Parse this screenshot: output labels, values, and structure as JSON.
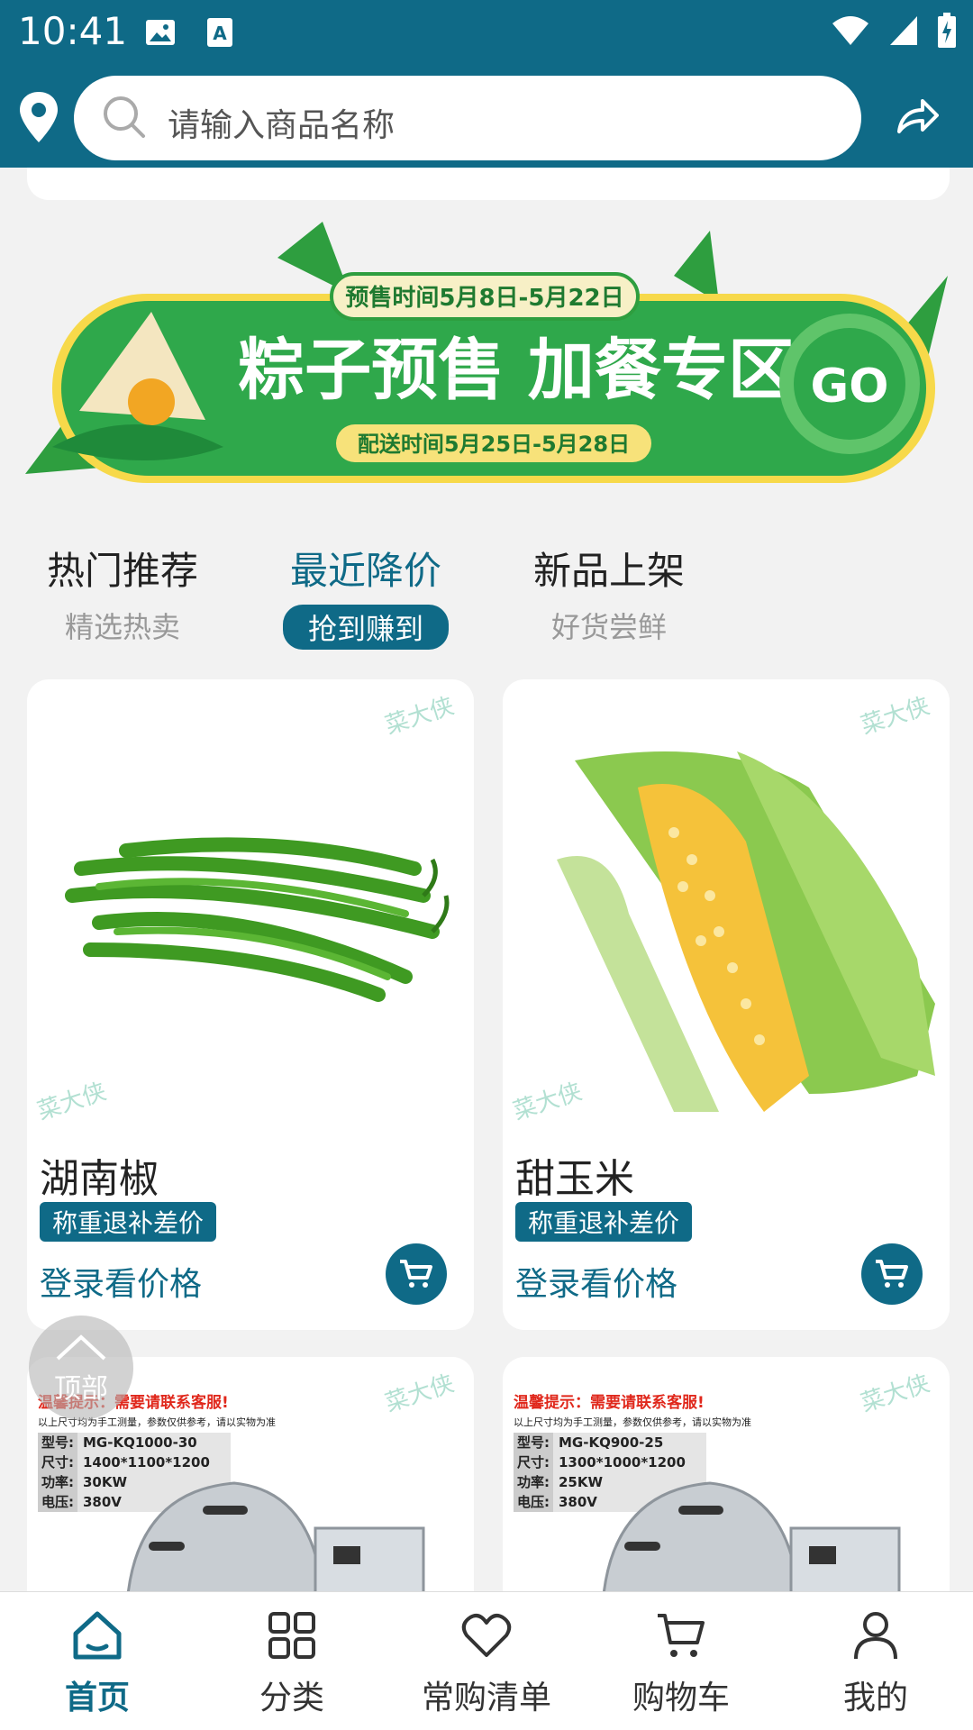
{
  "status_bar": {
    "time": "10:41"
  },
  "search": {
    "placeholder": "请输入商品名称"
  },
  "banner": {
    "presale_time": "预售时间5月8日-5月22日",
    "title": "粽子预售 加餐专区",
    "delivery_time": "配送时间5月25日-5月28日",
    "go_label": "GO"
  },
  "tabs": [
    {
      "label": "热门推荐",
      "sub": "精选热卖"
    },
    {
      "label": "最近降价",
      "sub": "抢到赚到"
    },
    {
      "label": "新品上架",
      "sub": "好货尝鲜"
    }
  ],
  "watermark": "菜大侠",
  "products": [
    {
      "name": "湖南椒",
      "tag": "称重退补差价",
      "price_text": "登录看价格"
    },
    {
      "name": "甜玉米",
      "tag": "称重退补差价",
      "price_text": "登录看价格"
    }
  ],
  "machines": [
    {
      "warning": "温馨提示：需要请联系客服!",
      "note": "以上尺寸均为手工测量，参数仅供参考，请以实物为准",
      "model_k": "型号:",
      "model": "MG-KQ1000-30",
      "size_k": "尺寸:",
      "size": "1400*1100*1200",
      "power_k": "功率:",
      "power": "30KW",
      "volt_k": "电压:",
      "volt": "380V"
    },
    {
      "warning": "温馨提示：需要请联系客服!",
      "note": "以上尺寸均为手工测量，参数仅供参考，请以实物为准",
      "model_k": "型号:",
      "model": "MG-KQ900-25",
      "size_k": "尺寸:",
      "size": "1300*1000*1200",
      "power_k": "功率:",
      "power": "25KW",
      "volt_k": "电压:",
      "volt": "380V"
    }
  ],
  "back_to_top": "顶部",
  "nav": [
    {
      "label": "首页"
    },
    {
      "label": "分类"
    },
    {
      "label": "常购清单"
    },
    {
      "label": "购物车"
    },
    {
      "label": "我的"
    }
  ],
  "colors": {
    "primary": "#0f6a87",
    "banner_green": "#2fa84b"
  }
}
